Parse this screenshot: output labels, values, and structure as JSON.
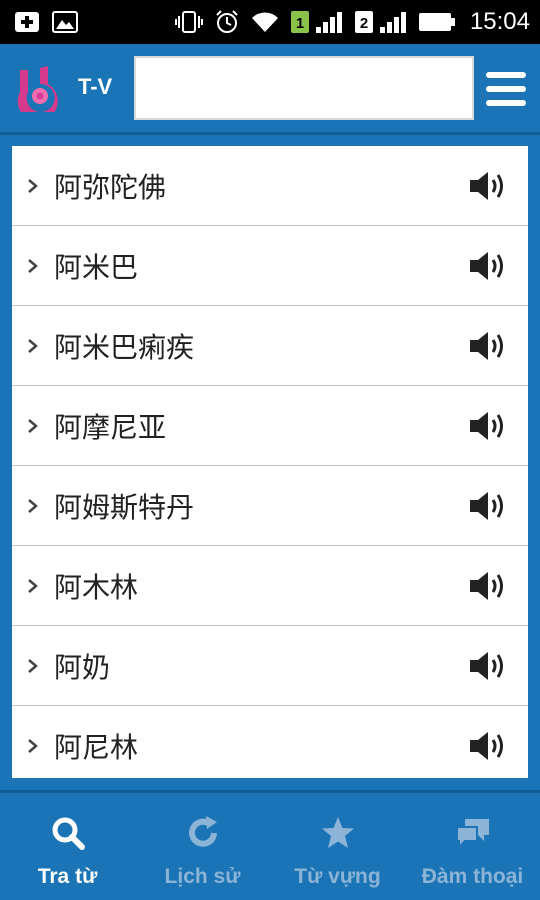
{
  "status_bar": {
    "time": "15:04",
    "sim1_label": "1",
    "sim2_label": "2",
    "icons": [
      "add-notification-icon",
      "image-notification-icon",
      "vibrate-icon",
      "alarm-icon",
      "wifi-icon",
      "sim1-signal-icon",
      "sim2-signal-icon",
      "battery-icon"
    ]
  },
  "header": {
    "title": "T-V",
    "search": {
      "value": "",
      "placeholder": ""
    },
    "logo": "app-logo-icon",
    "menu": "hamburger-menu-icon"
  },
  "words": [
    {
      "text": "阿弥陀佛"
    },
    {
      "text": "阿米巴"
    },
    {
      "text": "阿米巴痢疾"
    },
    {
      "text": "阿摩尼亚"
    },
    {
      "text": "阿姆斯特丹"
    },
    {
      "text": "阿木林"
    },
    {
      "text": "阿奶"
    },
    {
      "text": "阿尼林"
    }
  ],
  "bottom_nav": [
    {
      "label": "Tra từ",
      "icon": "search-icon",
      "active": true
    },
    {
      "label": "Lịch sử",
      "icon": "history-icon",
      "active": false
    },
    {
      "label": "Từ vựng",
      "icon": "star-icon",
      "active": false
    },
    {
      "label": "Đàm thoại",
      "icon": "chat-icon",
      "active": false
    }
  ],
  "colors": {
    "primary": "#1a74b5",
    "active_text": "#ffffff",
    "inactive_text": "#8cb4d6",
    "logo_pink": "#d63a8c"
  }
}
